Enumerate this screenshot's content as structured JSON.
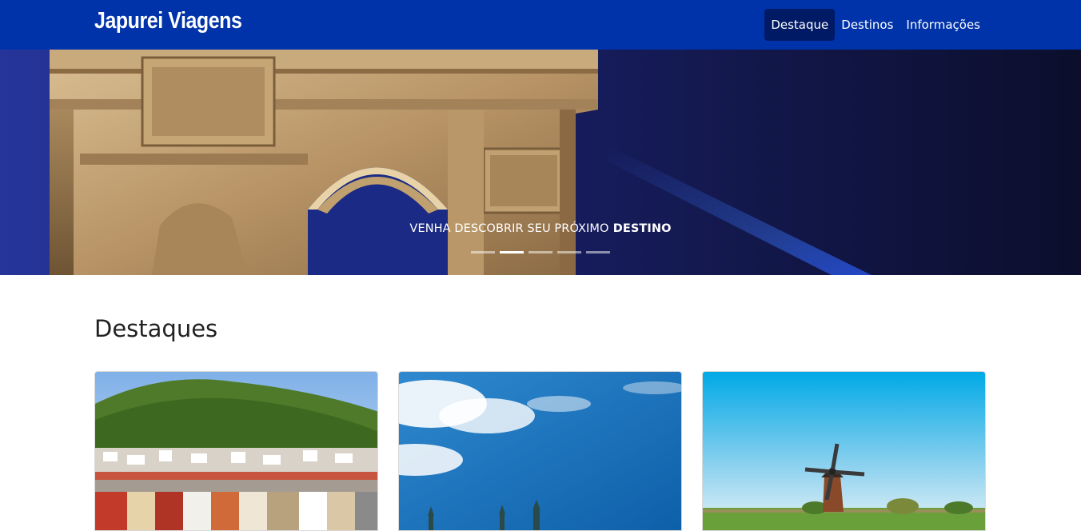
{
  "navbar": {
    "brand": "Japurei Viagens",
    "items": [
      {
        "label": "Destaque",
        "active": true
      },
      {
        "label": "Destinos",
        "active": false
      },
      {
        "label": "Informações",
        "active": false
      }
    ],
    "background_color": "#0033aa",
    "active_item_color": "#001a66"
  },
  "hero": {
    "caption_plain": "VENHA DESCOBRIR SEU PRÓXIMO",
    "caption_bold": "DESTINO",
    "slide_count": 5,
    "active_slide": 2,
    "image": "arc-de-triomphe-at-night"
  },
  "section": {
    "title": "Destaques"
  },
  "cards": [
    {
      "image": "bergen-hillside-town"
    },
    {
      "image": "blue-sky-city-spires"
    },
    {
      "image": "windmill-field"
    }
  ]
}
